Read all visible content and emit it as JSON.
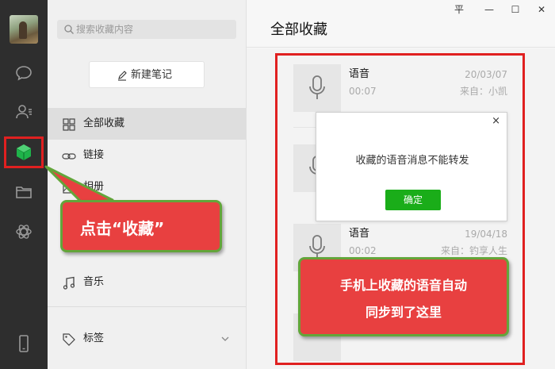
{
  "window": {
    "controls": [
      "平",
      "—",
      "☐",
      "✕"
    ]
  },
  "rail": {
    "icons": [
      "avatar",
      "chat-icon",
      "contacts-icon",
      "favorites-icon",
      "folder-icon",
      "mini-program-icon",
      "phone-icon"
    ]
  },
  "sidebar": {
    "search_placeholder": "搜索收藏内容",
    "new_note_label": "新建笔记",
    "items": [
      {
        "label": "全部收藏",
        "icon": "grid-icon"
      },
      {
        "label": "链接",
        "icon": "link-icon"
      },
      {
        "label": "相册",
        "icon": "image-icon"
      },
      {
        "label": "音乐",
        "icon": "music-icon"
      },
      {
        "label": "标签",
        "icon": "tag-icon"
      }
    ]
  },
  "main": {
    "title": "全部收藏",
    "items": [
      {
        "title": "语音",
        "duration": "00:07",
        "date": "20/03/07",
        "source": "来自：小凯"
      },
      {
        "title": "语音",
        "duration": "00:02",
        "date": "19/04/18",
        "source": "来自：钓享人生"
      }
    ]
  },
  "dialog": {
    "message": "收藏的语音消息不能转发",
    "ok_label": "确定"
  },
  "callouts": {
    "click_favorites": "点击“收藏”",
    "sync_line1": "手机上收藏的语音自动",
    "sync_line2": "同步到了这里"
  },
  "colors": {
    "rail_bg": "#2e2e2e",
    "accent_green": "#1aad19",
    "highlight_red": "#e02020",
    "callout_red": "#e84040",
    "callout_border": "#63a53a"
  }
}
